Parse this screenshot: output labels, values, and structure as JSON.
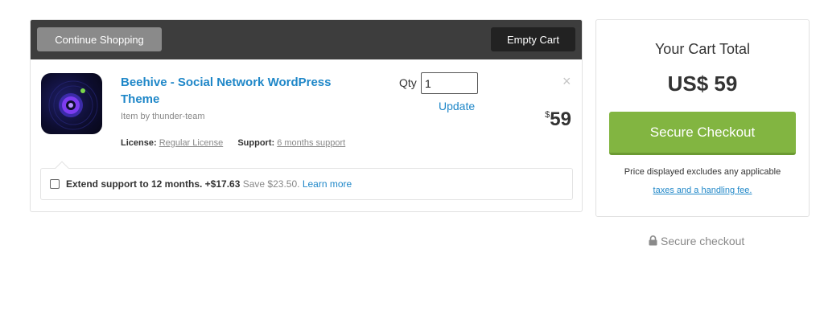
{
  "toolbar": {
    "continue_label": "Continue Shopping",
    "empty_label": "Empty Cart"
  },
  "item": {
    "icon": "beehive-logo",
    "title": "Beehive - Social Network WordPress Theme",
    "byline": "Item by thunder-team",
    "license_label": "License:",
    "license_value": "Regular License",
    "support_label": "Support:",
    "support_value": "6 months support",
    "qty_label": "Qty",
    "qty_value": "1",
    "update_label": "Update",
    "remove_glyph": "×",
    "price_currency": "$",
    "price_value": "59"
  },
  "extend": {
    "checked": false,
    "main_text": "Extend support to 12 months. +$17.63",
    "save_text": "Save $23.50.",
    "learn_label": "Learn more"
  },
  "summary": {
    "title": "Your Cart Total",
    "total": "US$ 59",
    "checkout_label": "Secure Checkout",
    "note": "Price displayed excludes any applicable",
    "link_label": "taxes and a handling fee."
  },
  "footer": {
    "secure_label": "Secure checkout",
    "icon": "lock-icon"
  },
  "colors": {
    "link": "#1f87c8",
    "checkout_green": "#82b541",
    "bar_dark": "#3d3d3d"
  }
}
